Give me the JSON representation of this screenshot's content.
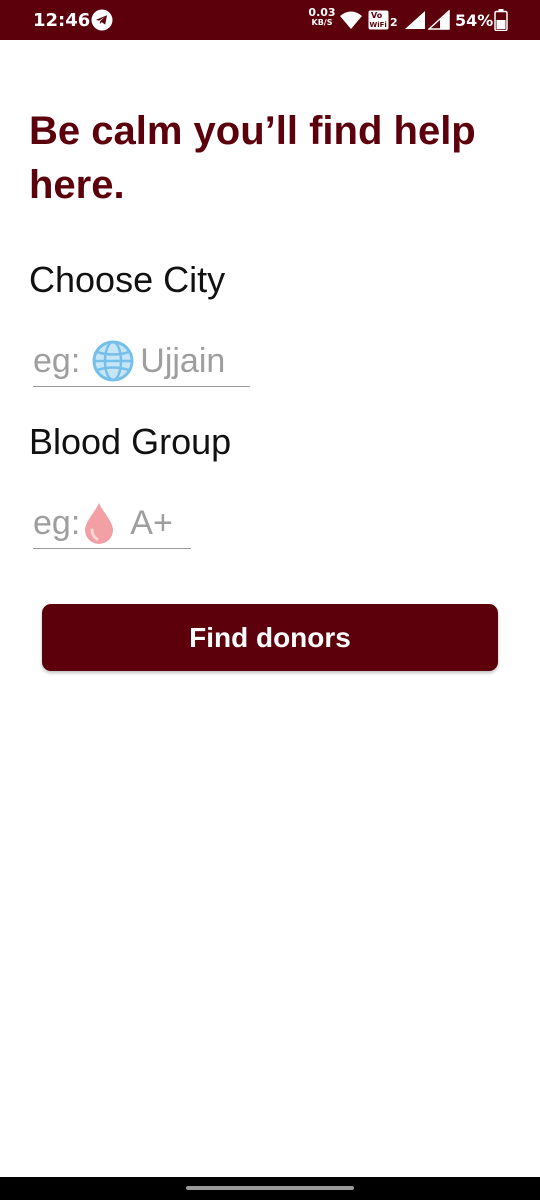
{
  "status_bar": {
    "time": "12:46",
    "net_speed_value": "0.03",
    "net_speed_unit": "KB/S",
    "volte_top": "Vo",
    "volte_bottom": "WiFi",
    "volte_sim": "2",
    "battery": "54%",
    "background_color": "#5c000b"
  },
  "main": {
    "headline": "Be calm you’ll find help here.",
    "city_label": "Choose City",
    "city_placeholder_prefix": "eg:",
    "city_placeholder_icon": "globe-icon",
    "city_placeholder_text": "Ujjain",
    "blood_label": "Blood Group",
    "blood_placeholder_prefix": "eg:",
    "blood_placeholder_icon": "blood-drop-icon",
    "blood_placeholder_text": "A+",
    "button_label": "Find donors",
    "accent_color": "#5c000b"
  }
}
